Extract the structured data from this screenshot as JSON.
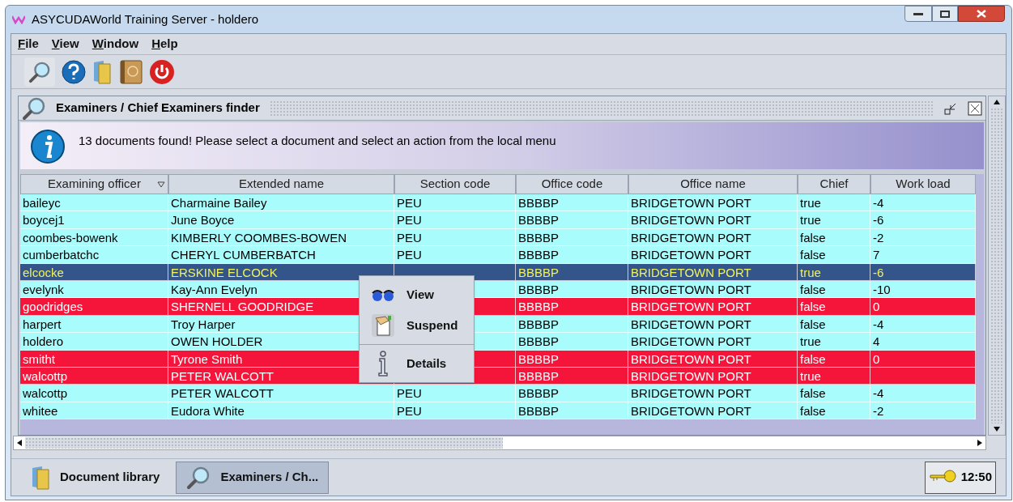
{
  "window": {
    "title": "ASYCUDAWorld Training Server - holdero"
  },
  "menu": [
    "File",
    "View",
    "Window",
    "Help"
  ],
  "frame": {
    "title": "Examiners / Chief Examiners finder",
    "message": "13 documents found! Please select a document and select an action from the local menu"
  },
  "table": {
    "columns": [
      {
        "label": "Examining officer",
        "sorted": true
      },
      {
        "label": "Extended name",
        "sorted": false
      },
      {
        "label": "Section code",
        "sorted": false
      },
      {
        "label": "Office code",
        "sorted": false
      },
      {
        "label": "Office name",
        "sorted": false
      },
      {
        "label": "Chief",
        "sorted": false
      },
      {
        "label": "Work load",
        "sorted": false
      }
    ],
    "rows": [
      {
        "kind": "normal",
        "selected": false,
        "cells": [
          "baileyc",
          "Charmaine Bailey",
          "PEU",
          "BBBBP",
          "BRIDGETOWN PORT",
          "true",
          "-4"
        ]
      },
      {
        "kind": "normal",
        "selected": false,
        "cells": [
          "boycej1",
          "June Boyce",
          "PEU",
          "BBBBP",
          "BRIDGETOWN PORT",
          "true",
          "-6"
        ]
      },
      {
        "kind": "normal",
        "selected": false,
        "cells": [
          "coombes-bowenk",
          "KIMBERLY COOMBES-BOWEN",
          "PEU",
          "BBBBP",
          "BRIDGETOWN PORT",
          "false",
          "-2"
        ]
      },
      {
        "kind": "normal",
        "selected": false,
        "cells": [
          "cumberbatchc",
          "CHERYL CUMBERBATCH",
          "PEU",
          "BBBBP",
          "BRIDGETOWN PORT",
          "false",
          "7"
        ]
      },
      {
        "kind": "normal",
        "selected": true,
        "cells": [
          "elcocke",
          "ERSKINE ELCOCK",
          "",
          "BBBBP",
          "BRIDGETOWN PORT",
          "true",
          "-6"
        ]
      },
      {
        "kind": "normal",
        "selected": false,
        "cells": [
          "evelynk",
          "Kay-Ann Evelyn",
          "",
          "BBBBP",
          "BRIDGETOWN PORT",
          "false",
          "-10"
        ]
      },
      {
        "kind": "suspended",
        "selected": false,
        "cells": [
          "goodridges",
          "SHERNELL GOODRIDGE",
          "",
          "BBBBP",
          "BRIDGETOWN PORT",
          "false",
          "0"
        ]
      },
      {
        "kind": "normal",
        "selected": false,
        "cells": [
          "harpert",
          "Troy Harper",
          "",
          "BBBBP",
          "BRIDGETOWN PORT",
          "false",
          "-4"
        ]
      },
      {
        "kind": "normal",
        "selected": false,
        "cells": [
          "holdero",
          "OWEN HOLDER",
          "",
          "BBBBP",
          "BRIDGETOWN PORT",
          "true",
          "4"
        ]
      },
      {
        "kind": "suspended",
        "selected": false,
        "cells": [
          "smitht",
          "Tyrone Smith",
          "",
          "BBBBP",
          "BRIDGETOWN PORT",
          "false",
          "0"
        ]
      },
      {
        "kind": "suspended",
        "selected": false,
        "cells": [
          "walcottp",
          "PETER WALCOTT",
          "",
          "BBBBP",
          "BRIDGETOWN PORT",
          "true",
          ""
        ]
      },
      {
        "kind": "normal",
        "selected": false,
        "cells": [
          "walcottp",
          "PETER WALCOTT",
          "PEU",
          "BBBBP",
          "BRIDGETOWN PORT",
          "false",
          "-4"
        ]
      },
      {
        "kind": "normal",
        "selected": false,
        "cells": [
          "whitee",
          "Eudora White",
          "PEU",
          "BBBBP",
          "BRIDGETOWN PORT",
          "false",
          "-2"
        ]
      }
    ]
  },
  "context_menu": [
    {
      "label": "View",
      "kind": "view"
    },
    {
      "label": "Suspend",
      "kind": "suspend"
    },
    {
      "label": "Details",
      "kind": "details"
    }
  ],
  "taskbar": {
    "items": [
      {
        "label": "Document library",
        "selected": false,
        "kind": "library"
      },
      {
        "label": "Examiners / Ch...",
        "selected": true,
        "kind": "finder"
      }
    ],
    "clock": "12:50"
  }
}
